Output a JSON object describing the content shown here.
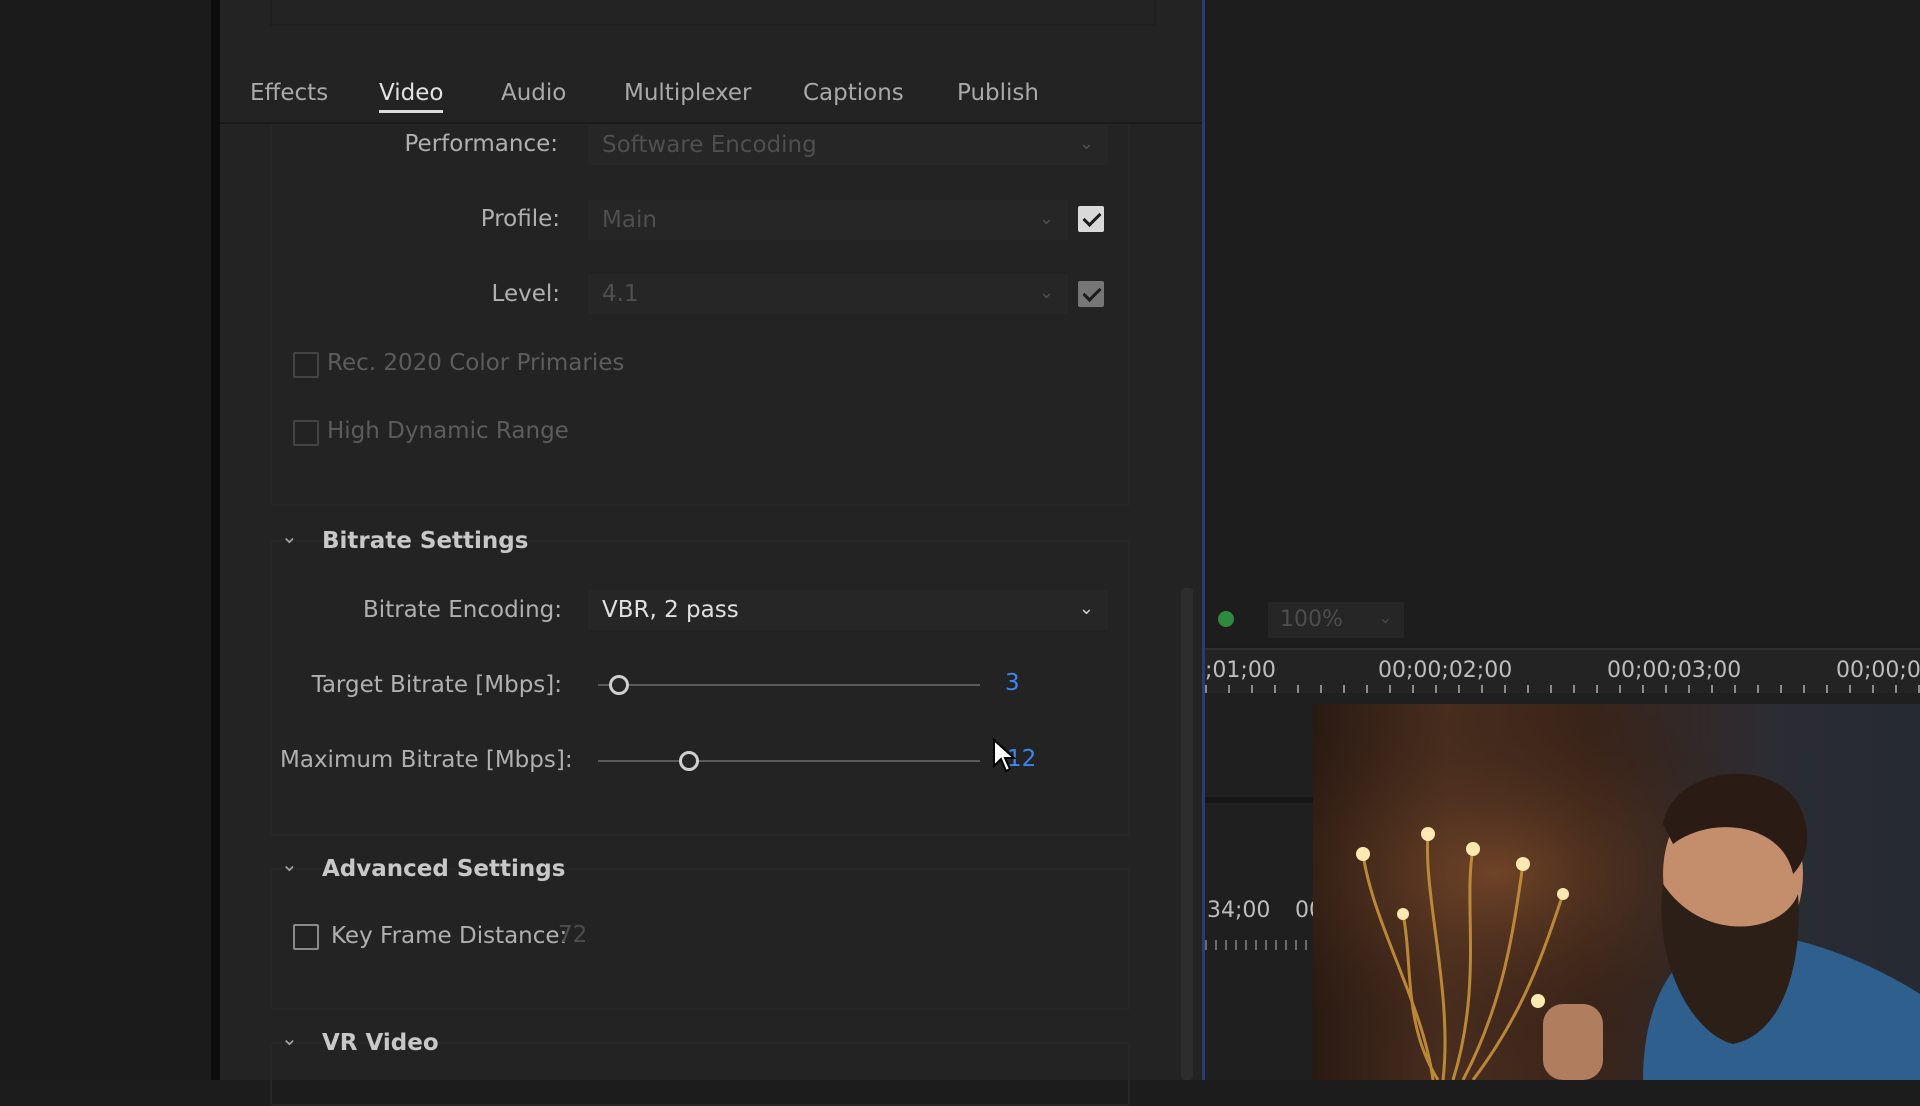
{
  "tabs": [
    "Effects",
    "Video",
    "Audio",
    "Multiplexer",
    "Captions",
    "Publish"
  ],
  "active_tab": "Video",
  "video": {
    "performance_label": "Performance:",
    "performance_value": "Software Encoding",
    "profile_label": "Profile:",
    "profile_value": "Main",
    "profile_checked": true,
    "level_label": "Level:",
    "level_value": "4.1",
    "level_checked": true,
    "rec2020_label": "Rec. 2020 Color Primaries",
    "hdr_label": "High Dynamic Range"
  },
  "bitrate": {
    "title": "Bitrate Settings",
    "encoding_label": "Bitrate Encoding:",
    "encoding_value": "VBR, 2 pass",
    "target_label": "Target Bitrate [Mbps]:",
    "target_value": "3",
    "max_label": "Maximum Bitrate [Mbps]:",
    "max_value": "12"
  },
  "advanced": {
    "title": "Advanced Settings",
    "keyframe_label": "Key Frame Distance:",
    "keyframe_value": "72",
    "keyframe_checked": false
  },
  "vr": {
    "title": "VR Video"
  },
  "monitor": {
    "zoom": "100%",
    "ruler_times": [
      ";01;00",
      "00;00;02;00",
      "00;00;03;00",
      "00;00;0"
    ],
    "mini_times": [
      "34;00",
      "00"
    ]
  },
  "colors": {
    "accent": "#3a86ee",
    "playhead": "#2a3b75",
    "status_green": "#2e8b3e"
  }
}
